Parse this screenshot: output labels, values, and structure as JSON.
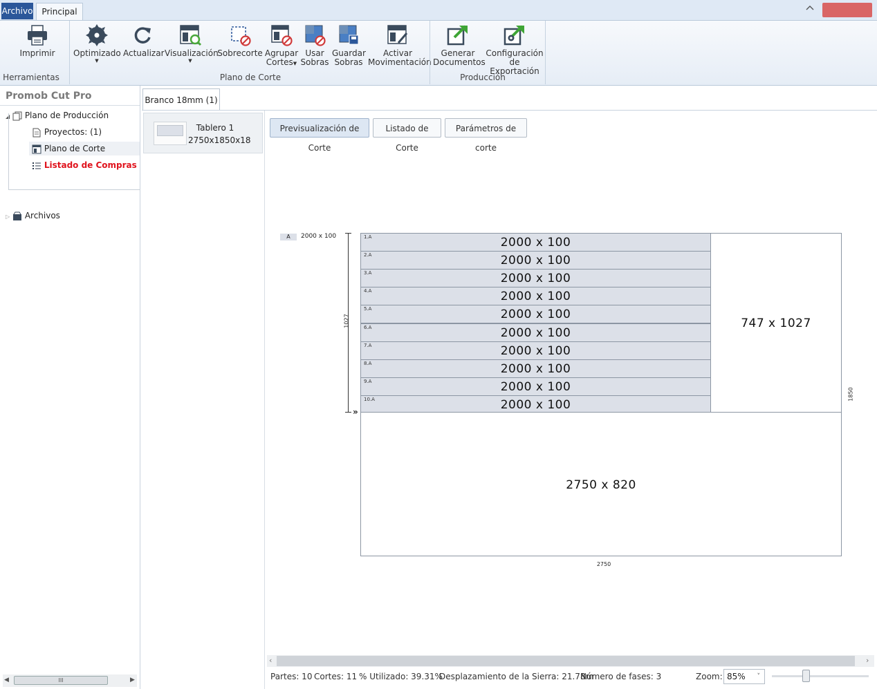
{
  "titlebar": {
    "tab_archivo": "Archivo",
    "tab_principal": "Principal",
    "collapse_icon": "chevron-up-icon"
  },
  "ribbon": {
    "groups": {
      "herramientas": "Herramientas",
      "plano_corte": "Plano de Corte",
      "produccion": "Producción"
    },
    "buttons": {
      "imprimir": "Imprimir",
      "optimizado": "Optimizado",
      "actualizar": "Actualizar",
      "visualizacion": "Visualización",
      "sobrecorte": "Sobrecorte",
      "agrupar_1": "Agrupar",
      "agrupar_2": "Cortes",
      "usar_1": "Usar",
      "usar_2": "Sobras",
      "guardar_1": "Guardar",
      "guardar_2": "Sobras",
      "activar_1": "Activar",
      "activar_2": "Movimentación",
      "generar_1": "Generar",
      "generar_2": "Documentos",
      "config_1": "Configuración",
      "config_2": "de Exportación"
    }
  },
  "sidebar": {
    "app_title": "Promob Cut Pro",
    "tree": {
      "plano_produccion": "Plano de Producción",
      "proyectos": "Proyectos: (1)",
      "plano_corte": "Plano de Corte",
      "listado_compras": "Listado de Compras",
      "archivos": "Archivos"
    },
    "accent_red": "#e0141e"
  },
  "material_tab": "Branco 18mm (1)",
  "board": {
    "name": "Tablero 1",
    "size": "2750x1850x18"
  },
  "view_tabs": [
    "Previsualización de Corte",
    "Listado de Corte",
    "Parámetros de corte"
  ],
  "drawing": {
    "legend_code": "A",
    "legend_size": "2000 x 100",
    "pieces": [
      {
        "label": "1.A",
        "dim": "2000 x 100"
      },
      {
        "label": "2.A",
        "dim": "2000 x 100"
      },
      {
        "label": "3.A",
        "dim": "2000 x 100"
      },
      {
        "label": "4.A",
        "dim": "2000 x 100"
      },
      {
        "label": "5.A",
        "dim": "2000 x 100"
      },
      {
        "label": "6.A",
        "dim": "2000 x 100"
      },
      {
        "label": "7.A",
        "dim": "2000 x 100"
      },
      {
        "label": "8.A",
        "dim": "2000 x 100"
      },
      {
        "label": "9.A",
        "dim": "2000 x 100"
      },
      {
        "label": "10.A",
        "dim": "2000 x 100"
      }
    ],
    "leftover_right": "747 x 1027",
    "leftover_bottom": "2750 x 820",
    "height_measure": "1027",
    "board_height": "1850",
    "board_width": "2750",
    "phase_marker": "»"
  },
  "status": {
    "partes": "Partes: 10",
    "cortes": "Cortes: 11",
    "utilizado": "% Utilizado: 39.31%",
    "desplazamiento": "Desplazamiento de la Sierra: 21.78m",
    "fases": "Número de fases: 3",
    "zoom_label": "Zoom:",
    "zoom_value": "85%"
  }
}
